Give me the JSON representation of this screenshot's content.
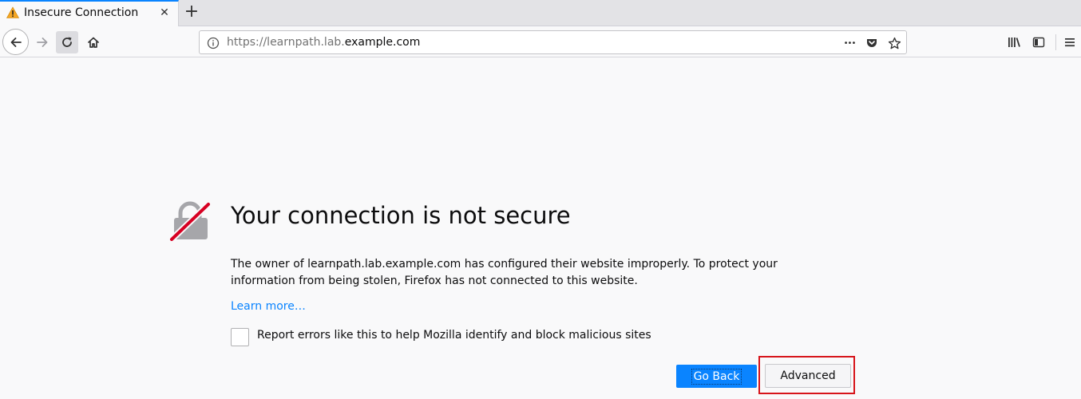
{
  "tab": {
    "title": "Insecure Connection",
    "close_glyph": "✕",
    "warning_icon": "warning-triangle-icon",
    "warning_color": "#f5a623"
  },
  "newtab_glyph": "+",
  "urlbar": {
    "prefix": "https://learnpath.lab.",
    "host": "example.com",
    "more_glyph": "•••"
  },
  "content": {
    "title": "Your connection is not secure",
    "description": "The owner of learnpath.lab.example.com has configured their website improperly. To protect your information from being stolen, Firefox has not connected to this website.",
    "learn_more": "Learn more…",
    "report_label": "Report errors like this to help Mozilla identify and block malicious sites",
    "report_checked": false,
    "go_back_label": "Go Back",
    "advanced_label": "Advanced"
  },
  "colors": {
    "accent": "#0a84ff",
    "highlight_box": "#d7141a",
    "lock_slash": "#d70022"
  }
}
